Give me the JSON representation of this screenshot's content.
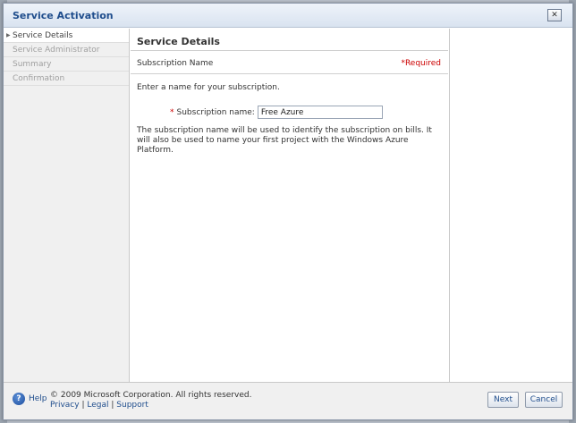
{
  "window": {
    "title": "Service Activation",
    "close_glyph": "✕"
  },
  "nav": {
    "items": [
      {
        "label": "Service Details",
        "active": true
      },
      {
        "label": "Service Administrator",
        "active": false
      },
      {
        "label": "Summary",
        "active": false
      },
      {
        "label": "Confirmation",
        "active": false
      }
    ]
  },
  "main": {
    "section_title": "Service Details",
    "sub_header": "Subscription Name",
    "required_note": "*Required",
    "instruction": "Enter a name for your subscription.",
    "field": {
      "required_star": "*",
      "label": "Subscription name:",
      "value": "Free Azure"
    },
    "help_text": "The subscription name will be used to identify the subscription on bills. It will also be used to name your first project with the Windows Azure Platform."
  },
  "footer": {
    "help_label": "Help",
    "copyright": "© 2009 Microsoft Corporation. All rights reserved.",
    "links": [
      "Privacy",
      "Legal",
      "Support"
    ],
    "next_label": "Next",
    "cancel_label": "Cancel"
  },
  "colors": {
    "title": "#1f4d8c",
    "required": "#cc0000",
    "link": "#1f4d8c"
  }
}
